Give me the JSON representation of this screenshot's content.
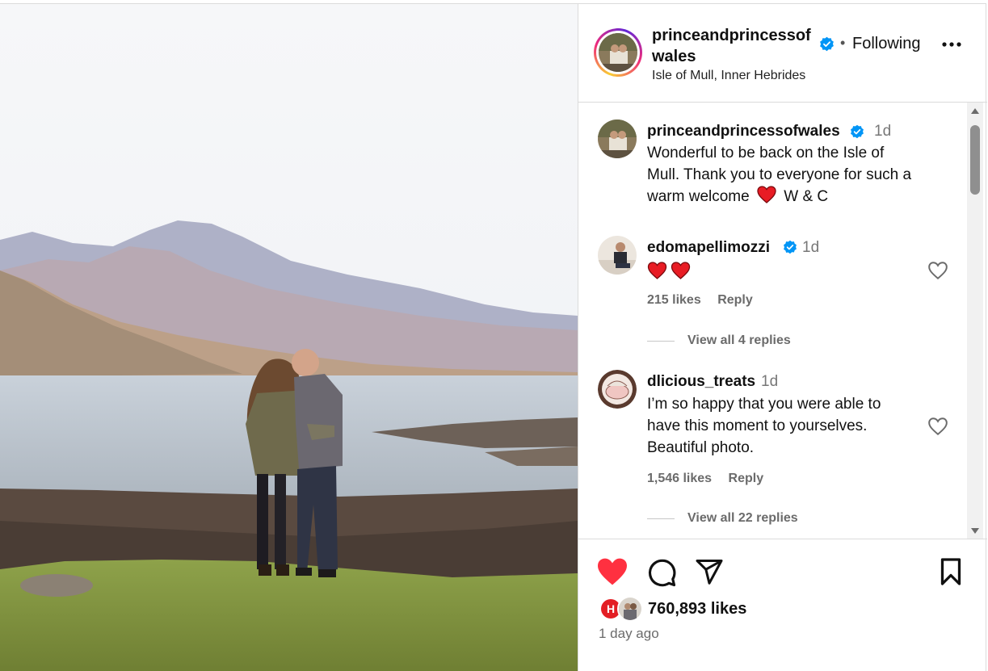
{
  "post": {
    "author": "princeandprincessofwales",
    "follow_label": "Following",
    "separator": "•",
    "location": "Isle of Mull, Inner Hebrides"
  },
  "caption": {
    "author": "princeandprincessofwales",
    "time": "1d",
    "text_line1": "Wonderful to be back on the Isle of",
    "text_line2": "Mull. Thank you to everyone for such a",
    "text_line3_before": "warm welcome",
    "text_line3_after": "W & C"
  },
  "comments": [
    {
      "author": "edomapellimozzi",
      "verified": true,
      "time": "1d",
      "likes": "215 likes",
      "reply_label": "Reply",
      "replies_label": "View all 4 replies"
    },
    {
      "author": "dlicious_treats",
      "verified": false,
      "time": "1d",
      "text_line1": "I’m so happy that you were able to",
      "text_line2": "have this moment to yourselves.",
      "text_line3": "Beautiful photo.",
      "likes": "1,546 likes",
      "reply_label": "Reply",
      "replies_label": "View all 22 replies"
    }
  ],
  "footer": {
    "likes": "760,893 likes",
    "time_ago": "1 day ago",
    "liked": true
  },
  "icons": {
    "verified": "verified-badge-icon",
    "like": "heart-icon",
    "comment": "comment-bubble-icon",
    "share": "paper-plane-icon",
    "save": "bookmark-icon",
    "more": "more-dots-icon"
  },
  "colors": {
    "accent_blue": "#0095f6",
    "like_red": "#ff3040",
    "muted_text": "#6b6b6b",
    "border": "#dbdbdb"
  }
}
